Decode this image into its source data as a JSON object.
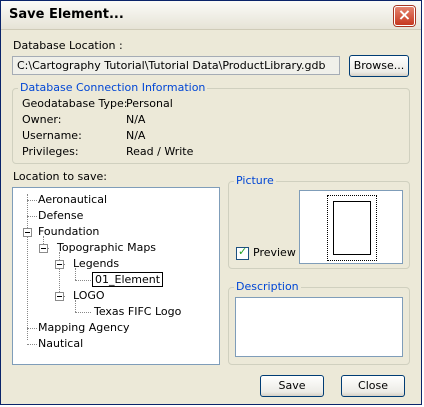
{
  "window": {
    "title": "Save Element..."
  },
  "database": {
    "label": "Database Location :",
    "path": "C:\\Cartography Tutorial\\Tutorial Data\\ProductLibrary.gdb",
    "browse_label": "Browse..."
  },
  "connection": {
    "group_title": "Database Connection Information",
    "rows": [
      {
        "label": "Geodatabase Type:",
        "value": "Personal"
      },
      {
        "label": "Owner:",
        "value": "N/A"
      },
      {
        "label": "Username:",
        "value": "N/A"
      },
      {
        "label": "Privileges:",
        "value": "Read / Write"
      }
    ]
  },
  "location": {
    "label": "Location to save:",
    "tree": [
      {
        "text": "Aeronautical"
      },
      {
        "text": "Defense"
      },
      {
        "text": "Foundation",
        "expanded": true
      },
      {
        "text": "Topographic Maps",
        "expanded": true
      },
      {
        "text": "Legends",
        "expanded": true
      },
      {
        "text": "01_Element",
        "editing": true
      },
      {
        "text": "LOGO",
        "expanded": true
      },
      {
        "text": "Texas FIFC Logo"
      },
      {
        "text": "Mapping Agency"
      },
      {
        "text": "Nautical"
      }
    ]
  },
  "picture": {
    "group_title": "Picture",
    "preview_label": "Preview",
    "preview_checked": true
  },
  "description": {
    "group_title": "Description",
    "value": ""
  },
  "actions": {
    "save_label": "Save",
    "close_label": "Close"
  }
}
